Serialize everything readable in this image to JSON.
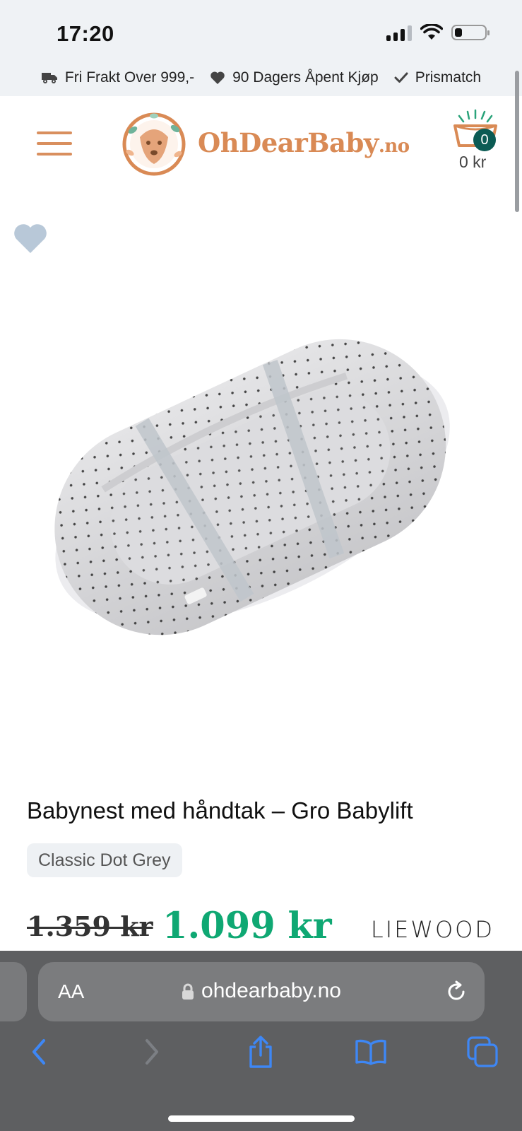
{
  "status_bar": {
    "time": "17:20"
  },
  "promo_bar": {
    "items": [
      {
        "icon": "truck-icon",
        "text": "Fri Frakt Over 999,-"
      },
      {
        "icon": "heart-icon",
        "text": "90 Dagers Åpent Kjøp"
      },
      {
        "icon": "check-icon",
        "text": "Prismatch"
      }
    ]
  },
  "header": {
    "logo_text": "OhDearBaby",
    "logo_suffix": ".no",
    "cart_count": "0",
    "cart_total": "0 kr"
  },
  "product": {
    "title": "Babynest med håndtak – Gro Babylift",
    "variant": "Classic Dot Grey",
    "old_price": "1.359 kr",
    "price": "1.099 kr",
    "brand": "LIEWOOD"
  },
  "browser": {
    "text_size_label": "AA",
    "url": "ohdearbaby.no"
  },
  "colors": {
    "brand_accent": "#d98a55",
    "sale_price": "#0fa873",
    "cart_badge": "#0b5b54",
    "promo_bg": "#eff2f5"
  }
}
